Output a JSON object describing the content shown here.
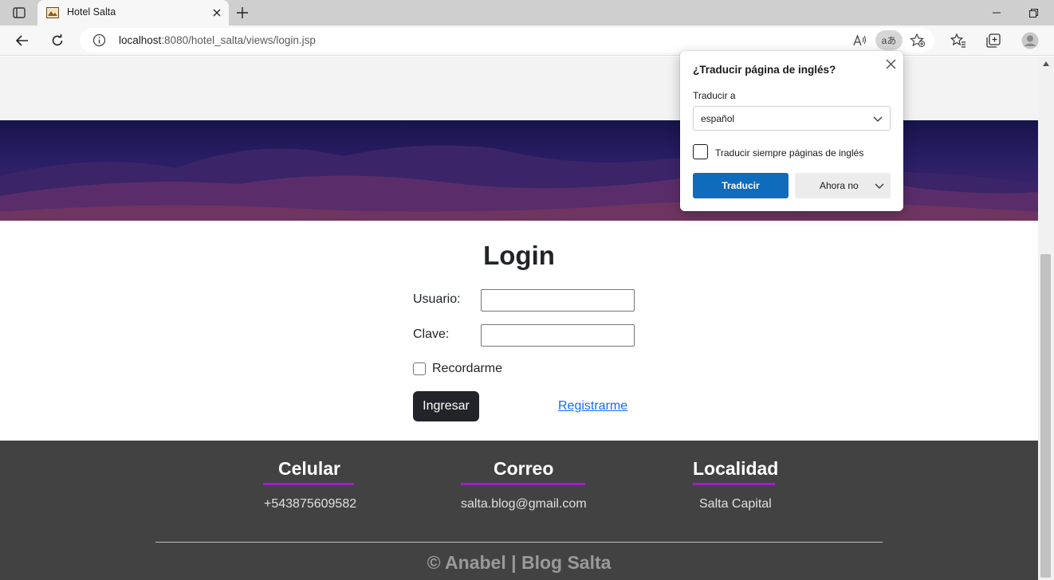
{
  "browser": {
    "tab_title": "Hotel Salta",
    "url_host": "localhost",
    "url_rest": ":8080/hotel_salta/views/login.jsp",
    "translate_badge": "aあ"
  },
  "login": {
    "title": "Login",
    "user_label": "Usuario:",
    "password_label": "Clave:",
    "user_value": "",
    "password_value": "",
    "remember_label": "Recordarme",
    "remember_checked": false,
    "submit_label": "Ingresar",
    "register_link": "Registrarme"
  },
  "footer": {
    "columns": [
      {
        "title": "Celular",
        "value": "+543875609582"
      },
      {
        "title": "Correo",
        "value": "salta.blog@gmail.com"
      },
      {
        "title": "Localidad",
        "value": "Salta Capital"
      }
    ],
    "copyright": "© Anabel | Blog Salta",
    "accent_color": "#a020c8"
  },
  "translate_popup": {
    "title": "¿Traducir página de inglés?",
    "target_label": "Traducir a",
    "target_language": "español",
    "always_label": "Traducir siempre páginas de inglés",
    "always_checked": false,
    "translate_button": "Traducir",
    "not_now_button": "Ahora no",
    "accent_color": "#0f6cbd"
  }
}
